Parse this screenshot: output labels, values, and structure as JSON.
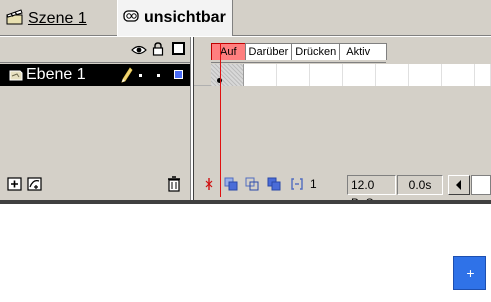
{
  "edit_bar": {
    "scene_label": "Szene 1",
    "symbol_label": "unsichtbar"
  },
  "timeline": {
    "layer": {
      "name": "Ebene 1"
    },
    "frame_labels": [
      {
        "label": "Auf",
        "active": true
      },
      {
        "label": "Darüber",
        "active": false
      },
      {
        "label": "Drücken",
        "active": false
      },
      {
        "label": "Aktiv",
        "active": false
      }
    ],
    "status": {
      "current_frame": "1",
      "frame_rate": "12.0 BpS",
      "elapsed": "0.0s"
    }
  },
  "colors": {
    "panel": "#d4d0c8",
    "active_label": "#ff7f7f",
    "playhead": "#e01010",
    "layer_highlight": "#000000",
    "registration_marker": "#2f72e8"
  },
  "icons": {
    "scene": "scene-icon",
    "symbol": "movie-clip-symbol-icon",
    "eye": "eye-icon",
    "lock": "lock-icon",
    "outline": "outline-icon",
    "layer": "layer-icon",
    "pencil": "pencil-icon",
    "insert_layer": "insert-layer-icon",
    "add_guide": "add-motion-guide-icon",
    "delete_layer": "trash-icon",
    "center_frame": "center-frame-icon",
    "onion_skin": "onion-skin-icon",
    "onion_outlines": "onion-skin-outlines-icon",
    "edit_multiple": "edit-multiple-frames-icon",
    "onion_markers": "modify-onion-markers-icon",
    "scroll_left": "scroll-left-arrow-icon",
    "registration": "plus-icon"
  }
}
